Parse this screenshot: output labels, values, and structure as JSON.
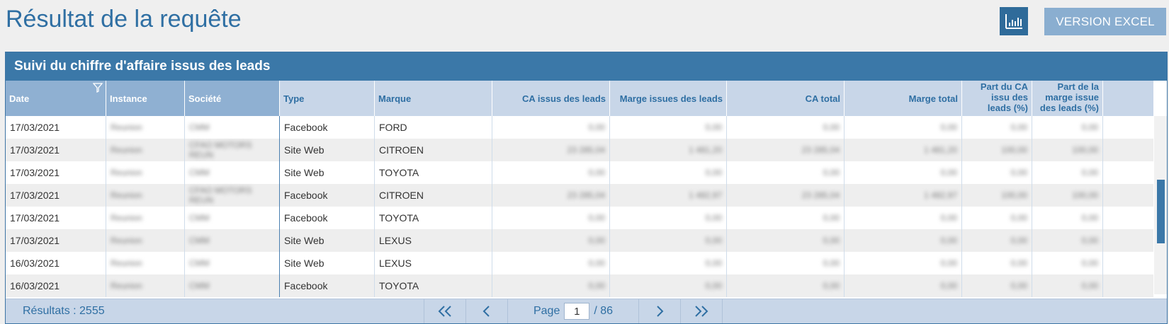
{
  "header": {
    "title": "Résultat de la requête",
    "excel_label": "VERSION EXCEL",
    "chart_icon": "bar-chart-icon"
  },
  "panel": {
    "title": "Suivi du chiffre d'affaire issus des leads"
  },
  "table": {
    "columns": [
      {
        "label": "Date"
      },
      {
        "label": "Instance"
      },
      {
        "label": "Société"
      },
      {
        "label": "Type"
      },
      {
        "label": "Marque"
      },
      {
        "label": "CA issus des leads"
      },
      {
        "label": "Marge issues des leads"
      },
      {
        "label": "CA total"
      },
      {
        "label": "Marge total"
      },
      {
        "label": "Part du CA issu des leads (%)"
      },
      {
        "label": "Part de la marge issue des leads (%)"
      }
    ],
    "rows": [
      {
        "date": "17/03/2021",
        "instance": "Reunion",
        "societe": "CMM",
        "type": "Facebook",
        "marque": "FORD",
        "ca_leads": "0,00",
        "marge_leads": "0,00",
        "ca_total": "0,00",
        "marge_total": "0,00",
        "part_ca": "0,00",
        "part_marge": "0,00"
      },
      {
        "date": "17/03/2021",
        "instance": "Reunion",
        "societe": "CFAO MOTORS REUN",
        "type": "Site Web",
        "marque": "CITROEN",
        "ca_leads": "23 285,04",
        "marge_leads": "1 481,20",
        "ca_total": "23 285,04",
        "marge_total": "1 481,20",
        "part_ca": "100,00",
        "part_marge": "100,00"
      },
      {
        "date": "17/03/2021",
        "instance": "Reunion",
        "societe": "CMM",
        "type": "Site Web",
        "marque": "TOYOTA",
        "ca_leads": "0,00",
        "marge_leads": "0,00",
        "ca_total": "0,00",
        "marge_total": "0,00",
        "part_ca": "0,00",
        "part_marge": "0,00"
      },
      {
        "date": "17/03/2021",
        "instance": "Reunion",
        "societe": "CFAO MOTORS REUN",
        "type": "Facebook",
        "marque": "CITROEN",
        "ca_leads": "23 285,04",
        "marge_leads": "1 482,97",
        "ca_total": "23 285,04",
        "marge_total": "1 482,97",
        "part_ca": "100,00",
        "part_marge": "100,00"
      },
      {
        "date": "17/03/2021",
        "instance": "Reunion",
        "societe": "CMM",
        "type": "Facebook",
        "marque": "TOYOTA",
        "ca_leads": "0,00",
        "marge_leads": "0,00",
        "ca_total": "0,00",
        "marge_total": "0,00",
        "part_ca": "0,00",
        "part_marge": "0,00"
      },
      {
        "date": "17/03/2021",
        "instance": "Reunion",
        "societe": "CMM",
        "type": "Site Web",
        "marque": "LEXUS",
        "ca_leads": "0,00",
        "marge_leads": "0,00",
        "ca_total": "0,00",
        "marge_total": "0,00",
        "part_ca": "0,00",
        "part_marge": "0,00"
      },
      {
        "date": "16/03/2021",
        "instance": "Reunion",
        "societe": "CMM",
        "type": "Site Web",
        "marque": "LEXUS",
        "ca_leads": "0,00",
        "marge_leads": "0,00",
        "ca_total": "0,00",
        "marge_total": "0,00",
        "part_ca": "0,00",
        "part_marge": "0,00"
      },
      {
        "date": "16/03/2021",
        "instance": "Reunion",
        "societe": "CMM",
        "type": "Facebook",
        "marque": "TOYOTA",
        "ca_leads": "0,00",
        "marge_leads": "0,00",
        "ca_total": "0,00",
        "marge_total": "0,00",
        "part_ca": "0,00",
        "part_marge": "0,00"
      }
    ]
  },
  "footer": {
    "results_label": "Résultats : 2555",
    "page_label": "Page",
    "current_page": "1",
    "total_pages": "/ 86"
  },
  "colors": {
    "accent": "#2f6fa3",
    "header_band": "#3b78a8",
    "column_header": "#c8d6e8"
  }
}
